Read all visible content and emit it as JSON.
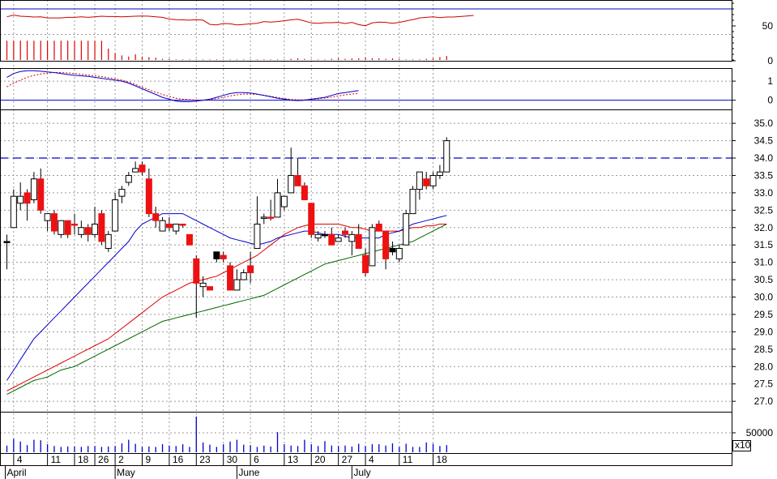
{
  "colors": {
    "up_candle": "#ffffff",
    "down_candle": "#ee1111",
    "dark_candle": "#000000",
    "ma_short": "#0000cc",
    "ma_mid": "#dd0000",
    "ma_long": "#006600",
    "rsi": "#cc0000",
    "resistance": "#0000cc",
    "grid": "#9a9a9a",
    "volume_bar": "#0000cc",
    "momentum_bar": "#dd0000"
  },
  "chart_data": {
    "type": "candlestick",
    "symbol": "",
    "x_axis": {
      "months": [
        {
          "label": "April",
          "index": 0
        },
        {
          "label": "May",
          "index": 16
        },
        {
          "label": "June",
          "index": 34
        },
        {
          "label": "July",
          "index": 51
        }
      ],
      "ticks": [
        {
          "label": "4",
          "index": 1
        },
        {
          "label": "11",
          "index": 6
        },
        {
          "label": "18",
          "index": 10
        },
        {
          "label": "26",
          "index": 13
        },
        {
          "label": "2",
          "index": 16
        },
        {
          "label": "9",
          "index": 20
        },
        {
          "label": "16",
          "index": 24
        },
        {
          "label": "23",
          "index": 28
        },
        {
          "label": "30",
          "index": 32
        },
        {
          "label": "6",
          "index": 36
        },
        {
          "label": "13",
          "index": 41
        },
        {
          "label": "20",
          "index": 45
        },
        {
          "label": "27",
          "index": 49
        },
        {
          "label": "4",
          "index": 53
        },
        {
          "label": "11",
          "index": 58
        },
        {
          "label": "18",
          "index": 63
        }
      ]
    },
    "price_panel": {
      "ylim": [
        26.7,
        35.4
      ],
      "tick_labels": [
        "35.0",
        "34.5",
        "34.0",
        "33.5",
        "33.0",
        "32.5",
        "32.0",
        "31.5",
        "31.0",
        "30.5",
        "30.0",
        "29.5",
        "29.0",
        "28.5",
        "28.0",
        "27.5",
        "27.0"
      ],
      "resistance_line": 34.0,
      "candles": [
        {
          "o": 31.6,
          "h": 31.8,
          "l": 30.8,
          "c": 31.6,
          "color": "black"
        },
        {
          "o": 32.0,
          "h": 33.1,
          "l": 32.0,
          "c": 32.9,
          "color": "up"
        },
        {
          "o": 32.7,
          "h": 33.3,
          "l": 32.5,
          "c": 32.9,
          "color": "up"
        },
        {
          "o": 33.0,
          "h": 33.1,
          "l": 32.2,
          "c": 32.7,
          "color": "down"
        },
        {
          "o": 32.8,
          "h": 33.6,
          "l": 32.7,
          "c": 33.4,
          "color": "up"
        },
        {
          "o": 33.4,
          "h": 33.7,
          "l": 32.4,
          "c": 32.5,
          "color": "down"
        },
        {
          "o": 32.2,
          "h": 32.4,
          "l": 31.9,
          "c": 32.4,
          "color": "up"
        },
        {
          "o": 32.4,
          "h": 32.5,
          "l": 31.8,
          "c": 31.9,
          "color": "down"
        },
        {
          "o": 31.8,
          "h": 32.2,
          "l": 31.7,
          "c": 32.2,
          "color": "up"
        },
        {
          "o": 32.2,
          "h": 32.2,
          "l": 31.7,
          "c": 31.8,
          "color": "down"
        },
        {
          "o": 32.1,
          "h": 32.4,
          "l": 31.8,
          "c": 32.1,
          "color": "down"
        },
        {
          "o": 31.8,
          "h": 32.2,
          "l": 31.7,
          "c": 32.0,
          "color": "up"
        },
        {
          "o": 32.0,
          "h": 32.1,
          "l": 31.6,
          "c": 31.8,
          "color": "down"
        },
        {
          "o": 31.8,
          "h": 32.6,
          "l": 31.7,
          "c": 32.1,
          "color": "up"
        },
        {
          "o": 32.4,
          "h": 32.5,
          "l": 31.5,
          "c": 31.6,
          "color": "down"
        },
        {
          "o": 31.4,
          "h": 31.9,
          "l": 31.3,
          "c": 31.8,
          "color": "up"
        },
        {
          "o": 31.9,
          "h": 33.0,
          "l": 31.9,
          "c": 32.8,
          "color": "up"
        },
        {
          "o": 32.9,
          "h": 33.2,
          "l": 32.7,
          "c": 33.1,
          "color": "up"
        },
        {
          "o": 33.3,
          "h": 33.6,
          "l": 33.2,
          "c": 33.5,
          "color": "up"
        },
        {
          "o": 33.6,
          "h": 33.9,
          "l": 33.6,
          "c": 33.7,
          "color": "up"
        },
        {
          "o": 33.8,
          "h": 33.9,
          "l": 33.5,
          "c": 33.6,
          "color": "down"
        },
        {
          "o": 33.4,
          "h": 33.7,
          "l": 32.3,
          "c": 32.4,
          "color": "down"
        },
        {
          "o": 32.4,
          "h": 32.6,
          "l": 32.0,
          "c": 32.2,
          "color": "down"
        },
        {
          "o": 31.9,
          "h": 32.3,
          "l": 31.9,
          "c": 32.2,
          "color": "up"
        },
        {
          "o": 32.1,
          "h": 32.3,
          "l": 31.9,
          "c": 32.0,
          "color": "down"
        },
        {
          "o": 31.9,
          "h": 32.1,
          "l": 31.8,
          "c": 32.1,
          "color": "up"
        },
        {
          "o": 32.1,
          "h": 32.1,
          "l": 32.0,
          "c": 32.1,
          "color": "down"
        },
        {
          "o": 31.8,
          "h": 31.8,
          "l": 31.5,
          "c": 31.5,
          "color": "down"
        },
        {
          "o": 31.1,
          "h": 31.2,
          "l": 29.4,
          "c": 30.4,
          "color": "down"
        },
        {
          "o": 30.3,
          "h": 30.6,
          "l": 30.0,
          "c": 30.4,
          "color": "up"
        },
        {
          "o": 30.3,
          "h": 30.3,
          "l": 30.2,
          "c": 30.2,
          "color": "down"
        },
        {
          "o": 31.1,
          "h": 31.2,
          "l": 31.0,
          "c": 31.3,
          "color": "black"
        },
        {
          "o": 31.2,
          "h": 31.3,
          "l": 31.0,
          "c": 31.1,
          "color": "down"
        },
        {
          "o": 30.9,
          "h": 31.0,
          "l": 30.2,
          "c": 30.2,
          "color": "down"
        },
        {
          "o": 30.2,
          "h": 30.8,
          "l": 30.2,
          "c": 30.5,
          "color": "up"
        },
        {
          "o": 30.5,
          "h": 30.8,
          "l": 30.5,
          "c": 30.7,
          "color": "up"
        },
        {
          "o": 30.9,
          "h": 31.3,
          "l": 30.4,
          "c": 30.7,
          "color": "down"
        },
        {
          "o": 31.4,
          "h": 32.9,
          "l": 31.4,
          "c": 32.1,
          "color": "up"
        },
        {
          "o": 32.3,
          "h": 32.4,
          "l": 32.1,
          "c": 32.3,
          "color": "up"
        },
        {
          "o": 32.3,
          "h": 32.8,
          "l": 32.2,
          "c": 32.3,
          "color": "down"
        },
        {
          "o": 32.3,
          "h": 33.4,
          "l": 32.3,
          "c": 33.0,
          "color": "up"
        },
        {
          "o": 32.6,
          "h": 32.9,
          "l": 32.5,
          "c": 32.9,
          "color": "up"
        },
        {
          "o": 33.0,
          "h": 34.3,
          "l": 33.0,
          "c": 33.5,
          "color": "up"
        },
        {
          "o": 33.5,
          "h": 34.0,
          "l": 33.2,
          "c": 33.2,
          "color": "down"
        },
        {
          "o": 33.2,
          "h": 33.3,
          "l": 32.8,
          "c": 32.8,
          "color": "down"
        },
        {
          "o": 32.7,
          "h": 32.7,
          "l": 31.7,
          "c": 31.8,
          "color": "down"
        },
        {
          "o": 31.7,
          "h": 31.9,
          "l": 31.6,
          "c": 31.8,
          "color": "up"
        },
        {
          "o": 31.8,
          "h": 31.9,
          "l": 31.7,
          "c": 31.8,
          "color": "black"
        },
        {
          "o": 31.8,
          "h": 32.0,
          "l": 31.5,
          "c": 31.5,
          "color": "down"
        },
        {
          "o": 31.6,
          "h": 31.8,
          "l": 31.6,
          "c": 31.7,
          "color": "up"
        },
        {
          "o": 31.9,
          "h": 32.0,
          "l": 31.7,
          "c": 31.8,
          "color": "down"
        },
        {
          "o": 31.6,
          "h": 31.9,
          "l": 31.2,
          "c": 31.8,
          "color": "up"
        },
        {
          "o": 31.8,
          "h": 32.1,
          "l": 31.6,
          "c": 31.4,
          "color": "down"
        },
        {
          "o": 31.2,
          "h": 31.4,
          "l": 30.6,
          "c": 30.7,
          "color": "down"
        },
        {
          "o": 30.9,
          "h": 32.1,
          "l": 30.9,
          "c": 32.0,
          "color": "up"
        },
        {
          "o": 32.1,
          "h": 32.2,
          "l": 31.9,
          "c": 31.9,
          "color": "down"
        },
        {
          "o": 31.9,
          "h": 31.9,
          "l": 30.8,
          "c": 31.1,
          "color": "down"
        },
        {
          "o": 31.4,
          "h": 31.6,
          "l": 31.2,
          "c": 31.3,
          "color": "black"
        },
        {
          "o": 31.1,
          "h": 31.5,
          "l": 31.0,
          "c": 31.4,
          "color": "up"
        },
        {
          "o": 31.5,
          "h": 32.5,
          "l": 31.5,
          "c": 32.4,
          "color": "up"
        },
        {
          "o": 32.4,
          "h": 33.2,
          "l": 32.4,
          "c": 33.1,
          "color": "up"
        },
        {
          "o": 33.1,
          "h": 33.5,
          "l": 32.8,
          "c": 33.6,
          "color": "up"
        },
        {
          "o": 33.4,
          "h": 33.6,
          "l": 33.1,
          "c": 33.2,
          "color": "down"
        },
        {
          "o": 33.2,
          "h": 33.6,
          "l": 33.1,
          "c": 33.5,
          "color": "up"
        },
        {
          "o": 33.5,
          "h": 33.8,
          "l": 33.4,
          "c": 33.6,
          "color": "up"
        },
        {
          "o": 33.6,
          "h": 34.6,
          "l": 33.6,
          "c": 34.5,
          "color": "up"
        }
      ],
      "ma_short": [
        27.6,
        27.9,
        28.2,
        28.5,
        28.8,
        29.0,
        29.2,
        29.4,
        29.6,
        29.8,
        30.0,
        30.2,
        30.4,
        30.6,
        30.8,
        31.0,
        31.2,
        31.4,
        31.6,
        31.9,
        32.1,
        32.2,
        32.3,
        32.4,
        32.4,
        32.4,
        32.4,
        32.3,
        32.2,
        32.1,
        32.0,
        31.9,
        31.8,
        31.7,
        31.65,
        31.6,
        31.55,
        31.5,
        31.55,
        31.6,
        31.7,
        31.75,
        31.8,
        31.85,
        31.9,
        31.9,
        31.85,
        31.8,
        31.8,
        31.8,
        31.75,
        31.7,
        31.7,
        31.7,
        31.7,
        31.7,
        31.8,
        31.85,
        31.9,
        32.0,
        32.1,
        32.15,
        32.2,
        32.25,
        32.3,
        32.35
      ],
      "ma_mid": [
        27.3,
        27.4,
        27.5,
        27.6,
        27.7,
        27.8,
        27.9,
        28.0,
        28.1,
        28.2,
        28.3,
        28.4,
        28.5,
        28.6,
        28.7,
        28.8,
        28.95,
        29.1,
        29.25,
        29.4,
        29.55,
        29.7,
        29.85,
        30.0,
        30.1,
        30.2,
        30.3,
        30.4,
        30.45,
        30.5,
        30.55,
        30.6,
        30.7,
        30.8,
        30.9,
        31.0,
        31.1,
        31.2,
        31.35,
        31.5,
        31.65,
        31.8,
        31.9,
        32.0,
        32.05,
        32.1,
        32.1,
        32.1,
        32.1,
        32.1,
        32.05,
        32.0,
        32.0,
        31.95,
        31.9,
        31.9,
        31.9,
        31.9,
        31.9,
        31.95,
        32.0,
        32.0,
        32.05,
        32.05,
        32.1,
        32.1
      ],
      "ma_long": [
        27.2,
        27.3,
        27.4,
        27.5,
        27.6,
        27.65,
        27.7,
        27.8,
        27.9,
        27.95,
        28.0,
        28.1,
        28.2,
        28.3,
        28.4,
        28.5,
        28.6,
        28.7,
        28.8,
        28.9,
        29.0,
        29.1,
        29.2,
        29.3,
        29.35,
        29.4,
        29.45,
        29.5,
        29.55,
        29.6,
        29.65,
        29.7,
        29.75,
        29.8,
        29.85,
        29.9,
        29.95,
        30.0,
        30.05,
        30.15,
        30.25,
        30.35,
        30.45,
        30.55,
        30.65,
        30.75,
        30.85,
        30.95,
        31.0,
        31.05,
        31.1,
        31.15,
        31.2,
        31.25,
        31.3,
        31.35,
        31.4,
        31.45,
        31.5,
        31.55,
        31.6,
        31.7,
        31.8,
        31.9,
        32.0,
        32.1
      ]
    },
    "rsi_panel": {
      "ylim": [
        0,
        100
      ],
      "tick_labels": [
        "50",
        "0"
      ],
      "reference_line": 100,
      "values": [
        72,
        78,
        74,
        73,
        71,
        72,
        68,
        68,
        68,
        70,
        70,
        72,
        70,
        72,
        74,
        73,
        73,
        72,
        73,
        74,
        75,
        74,
        72,
        70,
        64,
        62,
        61,
        60,
        62,
        60,
        45,
        43,
        48,
        47,
        43,
        45,
        47,
        49,
        55,
        53,
        55,
        58,
        61,
        63,
        57,
        50,
        49,
        51,
        51,
        52,
        48,
        52,
        44,
        40,
        50,
        53,
        52,
        49,
        52,
        57,
        62,
        68,
        70,
        72,
        69,
        71,
        71,
        73,
        75,
        77
      ],
      "momentum_bars": [
        34,
        34,
        34,
        34,
        34,
        34,
        34,
        34,
        34,
        34,
        34,
        34,
        34,
        34,
        34,
        20,
        12,
        8,
        6,
        10,
        6,
        5,
        4,
        2,
        2,
        1,
        1,
        1,
        1,
        1,
        1,
        1,
        1,
        1,
        1,
        1,
        1,
        1,
        1,
        1,
        -1,
        -1,
        -2,
        -3,
        -2,
        -1,
        -1,
        -1,
        -2,
        -3,
        -2,
        -3,
        -3,
        -4,
        -3,
        -3,
        -2,
        -3,
        -2,
        -1,
        1,
        1,
        2,
        3,
        5,
        7
      ]
    },
    "macd_panel": {
      "ylim": [
        -0.4,
        1.6
      ],
      "tick_labels": [
        "1",
        "0"
      ],
      "macd": [
        1.2,
        1.4,
        1.5,
        1.55,
        1.55,
        1.52,
        1.48,
        1.45,
        1.4,
        1.35,
        1.3,
        1.28,
        1.25,
        1.2,
        1.15,
        1.1,
        1.05,
        1.0,
        0.9,
        0.75,
        0.6,
        0.45,
        0.3,
        0.15,
        0.05,
        -0.05,
        -0.08,
        -0.08,
        -0.05,
        0.0,
        0.05,
        0.15,
        0.25,
        0.35,
        0.4,
        0.4,
        0.38,
        0.32,
        0.25,
        0.18,
        0.1,
        0.05,
        0.0,
        -0.02,
        0.0,
        0.05,
        0.1,
        0.15,
        0.25,
        0.35,
        0.4,
        0.45,
        0.5
      ],
      "signal": [
        0.7,
        0.9,
        1.05,
        1.2,
        1.3,
        1.38,
        1.42,
        1.45,
        1.45,
        1.43,
        1.4,
        1.36,
        1.32,
        1.28,
        1.24,
        1.18,
        1.12,
        1.05,
        0.95,
        0.82,
        0.68,
        0.55,
        0.42,
        0.3,
        0.2,
        0.1,
        0.05,
        0.02,
        0.0,
        0.0,
        0.02,
        0.08,
        0.15,
        0.22,
        0.28,
        0.32,
        0.32,
        0.3,
        0.26,
        0.2,
        0.14,
        0.08,
        0.04,
        0.02,
        0.02,
        0.04,
        0.07,
        0.11,
        0.16,
        0.22,
        0.28,
        0.32,
        0.36
      ]
    },
    "volume_panel": {
      "tick_labels": [
        "50000"
      ],
      "multiplier_label": "x10",
      "values": [
        15,
        30,
        24,
        16,
        28,
        27,
        18,
        14,
        12,
        13,
        13,
        12,
        14,
        14,
        12,
        13,
        14,
        20,
        28,
        19,
        12,
        13,
        12,
        18,
        15,
        14,
        18,
        12,
        80,
        22,
        17,
        12,
        18,
        24,
        28,
        17,
        16,
        12,
        15,
        13,
        45,
        18,
        15,
        14,
        28,
        18,
        14,
        25,
        15,
        14,
        15,
        13,
        19,
        14,
        18,
        18,
        15,
        20,
        12,
        19,
        12,
        12,
        22,
        19,
        14,
        16
      ]
    }
  }
}
